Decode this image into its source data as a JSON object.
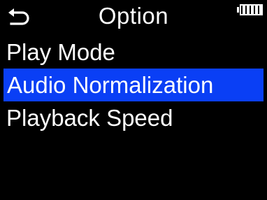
{
  "header": {
    "back_icon": "back-arrow-icon",
    "title": "Option",
    "battery_icon": "battery-icon"
  },
  "menu": {
    "items": [
      {
        "label": "Play Mode",
        "selected": false
      },
      {
        "label": "Audio Normalization",
        "selected": true
      },
      {
        "label": "Playback Speed",
        "selected": false
      }
    ]
  },
  "colors": {
    "background": "#000000",
    "text": "#ffffff",
    "selection": "#0a3ff5"
  }
}
